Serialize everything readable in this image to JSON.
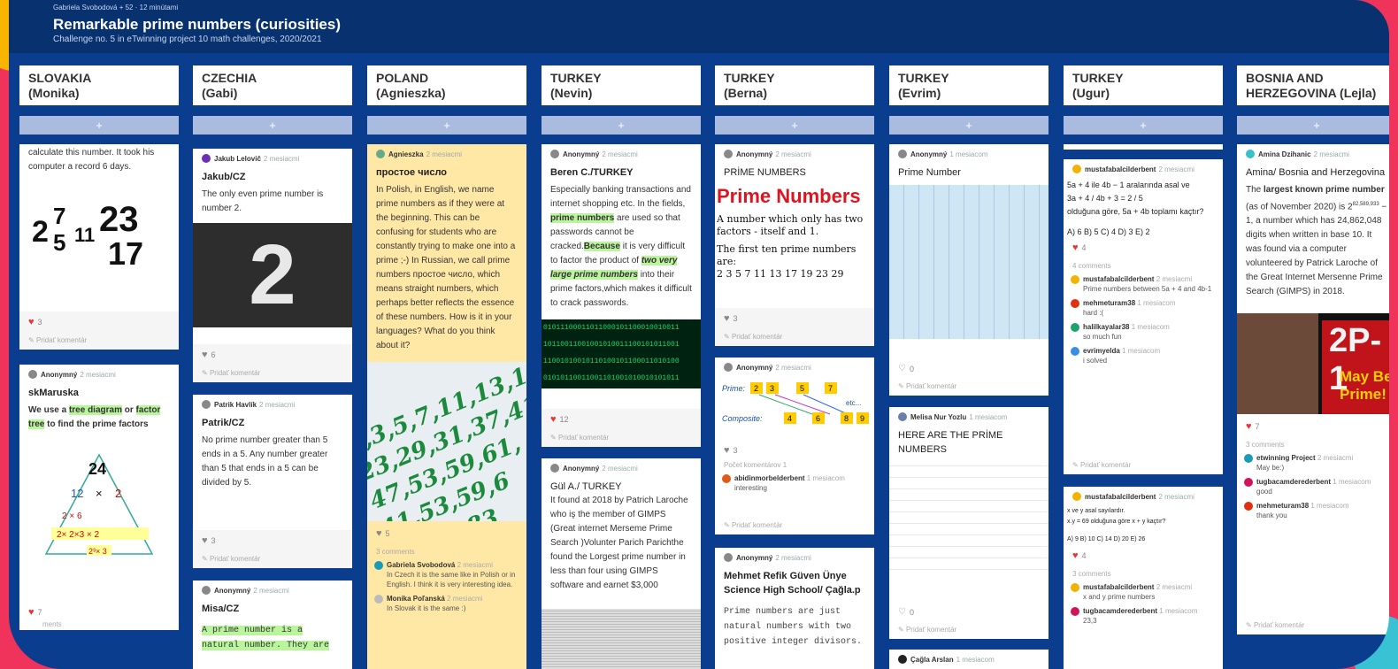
{
  "header": {
    "meta": "Gabriela Svobodová  +  52  ·  12 minútami",
    "title": "Remarkable prime numbers (curiosities)",
    "subtitle": "Challenge no. 5 in eTwinning project 10 math challenges, 2020/2021"
  },
  "ui": {
    "add": "+",
    "add_comment": "Pridať komentár",
    "three_comments": "3 comments",
    "four_comments": "4 comments"
  },
  "columns": [
    {
      "h1": "SLOVAKIA",
      "h2": "(Monika)"
    },
    {
      "h1": "CZECHIA",
      "h2": "(Gabi)"
    },
    {
      "h1": "POLAND",
      "h2": "(Agnieszka)"
    },
    {
      "h1": "TURKEY",
      "h2": "(Nevin)"
    },
    {
      "h1": "TURKEY",
      "h2": "(Berna)"
    },
    {
      "h1": "TURKEY",
      "h2": "(Evrim)"
    },
    {
      "h1": "TURKEY",
      "h2": "(Ugur)"
    },
    {
      "h1": "BOSNIA AND",
      "h2": "HERZEGOVINA  (Lejla)"
    }
  ],
  "c1": {
    "a_text": "calculate this number. It took his computer a record 6 days.",
    "a_likes": "3",
    "b_author": "Anonymný",
    "b_ago": "2 mesiacmi",
    "b_title": "skMaruska",
    "b_t1": "We use a ",
    "b_h1": "tree diagram",
    "b_t2": " or ",
    "b_h2": "factor tree",
    "b_t3": " to find the prime factors",
    "tree_top": "24",
    "tree_l": "12",
    "tree_r": "2",
    "tree_x": "×",
    "tree_ll": "2 × 6",
    "tree_row": "2× 2×3  ×  2",
    "tree_bottom": "2³× 3",
    "b_likes": "7",
    "b_comments": "ments",
    "b_last": "ská 2 mesiacmi"
  },
  "c2": {
    "a_author": "Jakub Lelovič",
    "a_ago": "2 mesiacmi",
    "a_title": "Jakub/CZ",
    "a_text": "The only even prime number is number 2.",
    "a_digit": "2",
    "a_likes": "6",
    "b_author": "Patrik Havlík",
    "b_ago": "2 mesiacmi",
    "b_title": "Patrik/CZ",
    "b_text": "No prime number greater than 5 ends in a 5. Any number greater than 5 that ends in a 5 can be divided by 5.",
    "b_likes": "3",
    "c_author": "Anonymný",
    "c_ago": "2 mesiacmi",
    "c_title": "Misa/CZ",
    "c_text1": "A prime number is a",
    "c_text2": "natural number. They are"
  },
  "c3": {
    "author": "Agnieszka",
    "ago": "2 mesiacmi",
    "title": "простое число",
    "text": "In Polish, in English, we name prime numbers as if they were at the beginning. This can be confusing for students who are constantly trying to make one into a prime ;-) In Russian, we call prime numbers простое число, which means straight numbers, which perhaps better reflects the essence of these numbers. How is it in your languages? What do you think about it?",
    "hw1": "2,3,5,7,11,13,17,19,",
    "hw2": "23,29,31,37,41,43,",
    "hw3": "47,53,59,61,",
    "hw4": "41,53,59,6",
    "hw5": "43,47,83",
    "likes": "5",
    "comments": "3 comments",
    "cm1_name": "Gabriela Svobodová",
    "cm1_ago": "2 mesiacmi",
    "cm1_text": "In Czech it is the same like in Polish or in English. I think it is very interesting idea.",
    "cm2_name": "Monika Poľanská",
    "cm2_ago": "2 mesiacmi",
    "cm2_text": "In Slovak it is the same :)"
  },
  "c4": {
    "a_author": "Anonymný",
    "a_ago": "2 mesiacmi",
    "a_title": "Beren C./TURKEY",
    "a_t1": "Especially banking transactions and internet shopping etc. In the fields, ",
    "a_h1": "prime numbers",
    "a_t2": " are used so that passwords cannot be cracked.",
    "a_h2": "Because",
    "a_t3": " it is very difficult to factor the product of ",
    "a_h3": "two very large prime numbers",
    "a_t4": " into their prime factors,which makes it difficult to crack passwords.",
    "binary1": "01011100011011000101100010010011",
    "binary2": "10110011001001010011100101011001",
    "binary3": "11001010010110100101100011010100",
    "binary4": "01010110011001101001010010101011",
    "a_likes": "12",
    "b_author": "Anonymný",
    "b_ago": "2 mesiacmi",
    "b_title": "Gül A./ TURKEY",
    "b_text": "It found at 2018 by Patrich Laroche who iş the member of GIMPS (Great internet Merseme Prime Search )Volunter Parich Parichthe found the Lorgest prime number in less than four using GIMPS software and earnet $3,000"
  },
  "c5": {
    "a_author": "Anonymný",
    "a_ago": "2 mesiacmi",
    "a_title": "PRİME NUMBERS",
    "pn_title": "Prime Numbers",
    "pn_t1": "A number which only has two factors - itself and 1.",
    "pn_t2": "The first ten prime numbers are:",
    "pn_list": "2  3  5  7  11  13  17  19  23  29",
    "a_likes": "3",
    "b_author": "Anonymný",
    "b_ago": "2 mesiacmi",
    "d_prime": "Prime:",
    "d_composite": "Composite:",
    "d_etc": "etc...",
    "d_p1": "2",
    "d_p2": "3",
    "d_p3": "5",
    "d_p4": "7",
    "d_c1": "4",
    "d_c2": "6",
    "d_c3": "8",
    "d_c4": "9",
    "b_likes": "3",
    "b_comment_count": "Počet komentárov 1",
    "b_cm_name": "abidinmorbelderbent",
    "b_cm_ago": "1 mesiacom",
    "b_cm_text": "interesting",
    "c_author": "Anonymný",
    "c_ago": "2 mesiacmi",
    "c_title": "Mehmet Refik Güven Ünye Science High School/ Çağla.p",
    "c_text1": "Prime numbers are just",
    "c_text2": "natural numbers with two",
    "c_text3": "positive integer divisors."
  },
  "c6": {
    "a_author": "Anonymný",
    "a_ago": "1 mesiacom",
    "a_title": "Prime Number",
    "a_likes": "0",
    "b_author": "Melisa Nur Yozlu",
    "b_ago": "1 mesiacom",
    "b_title": "HERE ARE THE PRİME NUMBERS",
    "b_likes": "0",
    "c_author": "Çağla Arslan",
    "c_ago": "1 mesiacom"
  },
  "c7": {
    "a_author": "mustafabalcilderbent",
    "a_ago": "2 mesiacmi",
    "a_q1": "5a + 4 ile 4b − 1 aralarında asal ve",
    "a_frac": "3a + 4 / 4b + 3  =  2 / 5",
    "a_q2": "olduğuna göre, 5a + 4b toplamı kaçtır?",
    "a_opts": "A) 6   B) 5   C) 4   D) 3   E) 2",
    "a_likes": "4",
    "a_comments": "4 comments",
    "cm1_name": "mustafabalcilderbent",
    "cm1_ago": "2 mesiacmi",
    "cm1_text": "Prime numbers between 5a + 4 and 4b-1",
    "cm2_name": "mehmeturam38",
    "cm2_ago": "1 mesiacom",
    "cm2_text": "hard :(",
    "cm3_name": "halilkayalar38",
    "cm3_ago": "1 mesiacom",
    "cm3_text": "so much fun",
    "cm4_name": "evrimyelda",
    "cm4_ago": "1 mesiacom",
    "cm4_text": "i solved",
    "b_author": "mustafabalcilderbent",
    "b_ago": "2 mesiacmi",
    "b_q1": "x ve y asal sayılardır.",
    "b_q2": "x.y = 69  olduğuna göre x + y kaçtır?",
    "b_opts": "A) 9       B) 10       C) 14       D) 20       E) 26",
    "b_likes": "4",
    "b_comments": "3 comments",
    "cm5_name": "mustafabalcilderbent",
    "cm5_ago": "2 mesiacmi",
    "cm5_text": "x and y prime numbers",
    "cm6_name": "tugbacamderederbent",
    "cm6_ago": "1 mesiacom",
    "cm6_text": "23,3"
  },
  "c8": {
    "a_author": "Amina Dzihanic",
    "a_ago": "2 mesiacmi",
    "a_title": "Amina/ Bosnia and Herzegovina",
    "a_t0": "The ",
    "a_b1": "largest known prime number",
    "a_t1": " (as of November 2020) is 2",
    "a_sup": "82,589,933",
    "a_t2": " − 1, a number which has 24,862,048 digits when written in base 10. It was found via a computer volunteered by Patrick Laroche of the Great Internet Mersenne Prime Search (GIMPS) in 2018.",
    "img_formula": "2P-1",
    "img_caption": "May Be Prime!",
    "a_likes": "7",
    "a_comments": "3 comments",
    "cm1_name": "etwinning Project",
    "cm1_ago": "2 mesiacmi",
    "cm1_text": "May be:)",
    "cm2_name": "tugbacamderederbent",
    "cm2_ago": "1 mesiacom",
    "cm2_text": "good",
    "cm3_name": "mehmeturam38",
    "cm3_ago": "1 mesiacom",
    "cm3_text": "thank you"
  }
}
